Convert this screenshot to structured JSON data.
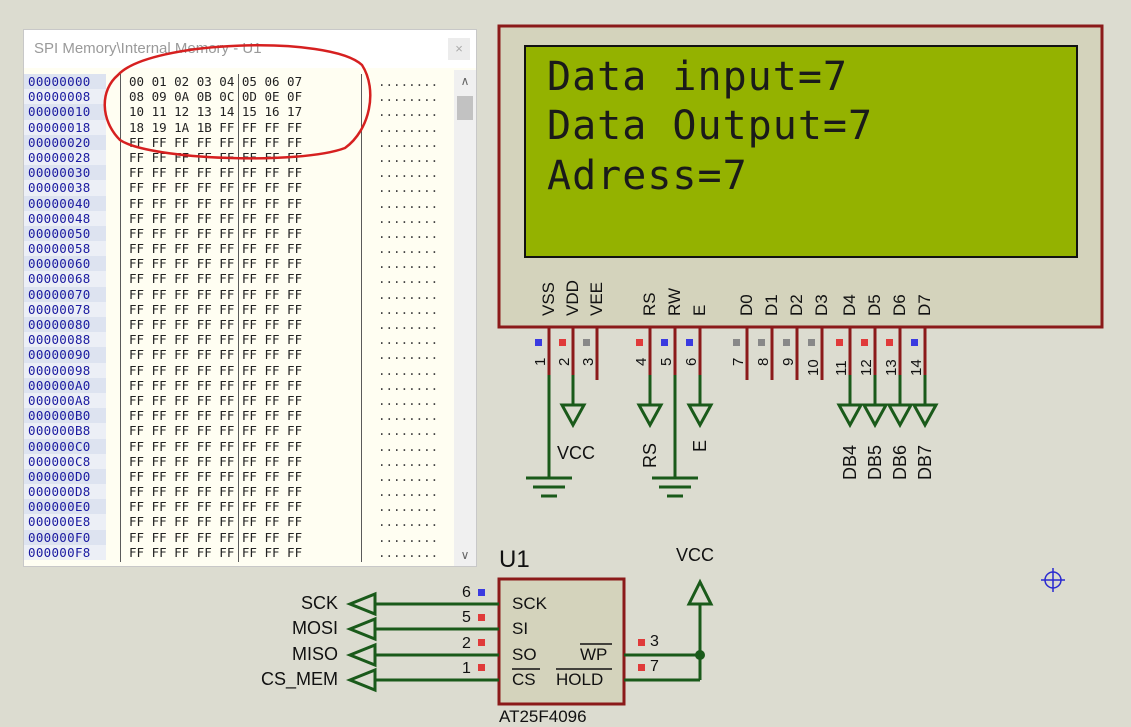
{
  "memory_window": {
    "title": "SPI Memory\\Internal Memory - U1",
    "close_glyph": "×",
    "addresses": [
      "00000000",
      "00000008",
      "00000010",
      "00000018",
      "00000020",
      "00000028",
      "00000030",
      "00000038",
      "00000040",
      "00000048",
      "00000050",
      "00000058",
      "00000060",
      "00000068",
      "00000070",
      "00000078",
      "00000080",
      "00000088",
      "00000090",
      "00000098",
      "000000A0",
      "000000A8",
      "000000B0",
      "000000B8",
      "000000C0",
      "000000C8",
      "000000D0",
      "000000D8",
      "000000E0",
      "000000E8",
      "000000F0",
      "000000F8"
    ],
    "hex_rows": [
      "00 01 02 03 04 05 06 07",
      "08 09 0A 0B 0C 0D 0E 0F",
      "10 11 12 13 14 15 16 17",
      "18 19 1A 1B FF FF FF FF",
      "FF FF FF FF FF FF FF FF",
      "FF FF FF FF FF FF FF FF",
      "FF FF FF FF FF FF FF FF",
      "FF FF FF FF FF FF FF FF",
      "FF FF FF FF FF FF FF FF",
      "FF FF FF FF FF FF FF FF",
      "FF FF FF FF FF FF FF FF",
      "FF FF FF FF FF FF FF FF",
      "FF FF FF FF FF FF FF FF",
      "FF FF FF FF FF FF FF FF",
      "FF FF FF FF FF FF FF FF",
      "FF FF FF FF FF FF FF FF",
      "FF FF FF FF FF FF FF FF",
      "FF FF FF FF FF FF FF FF",
      "FF FF FF FF FF FF FF FF",
      "FF FF FF FF FF FF FF FF",
      "FF FF FF FF FF FF FF FF",
      "FF FF FF FF FF FF FF FF",
      "FF FF FF FF FF FF FF FF",
      "FF FF FF FF FF FF FF FF",
      "FF FF FF FF FF FF FF FF",
      "FF FF FF FF FF FF FF FF",
      "FF FF FF FF FF FF FF FF",
      "FF FF FF FF FF FF FF FF",
      "FF FF FF FF FF FF FF FF",
      "FF FF FF FF FF FF FF FF",
      "FF FF FF FF FF FF FF FF",
      "FF FF FF FF FF FF FF FF"
    ],
    "ascii_row": "........",
    "scroll_down_glyph": "∨",
    "highlight_color": "#d62020"
  },
  "lcd": {
    "lines": [
      "Data input=7",
      "Data Output=7",
      "Adress=7"
    ],
    "screen_color": "#94b200",
    "frame_color": "#8b1a1a",
    "pins": [
      {
        "name": "VSS",
        "num": "1"
      },
      {
        "name": "VDD",
        "num": "2"
      },
      {
        "name": "VEE",
        "num": "3"
      },
      {
        "name": "RS",
        "num": "4"
      },
      {
        "name": "RW",
        "num": "5"
      },
      {
        "name": "E",
        "num": "6"
      },
      {
        "name": "D0",
        "num": "7"
      },
      {
        "name": "D1",
        "num": "8"
      },
      {
        "name": "D2",
        "num": "9"
      },
      {
        "name": "D3",
        "num": "10"
      },
      {
        "name": "D4",
        "num": "11"
      },
      {
        "name": "D5",
        "num": "12"
      },
      {
        "name": "D6",
        "num": "13"
      },
      {
        "name": "D7",
        "num": "14"
      }
    ],
    "net_vcc": "VCC",
    "net_rs": "RS",
    "net_e": "E",
    "net_db": [
      "DB4",
      "DB5",
      "DB6",
      "DB7"
    ]
  },
  "chip": {
    "ref": "U1",
    "part": "AT25F4096",
    "left_pins": [
      {
        "name": "SCK",
        "num": "6"
      },
      {
        "name": "SI",
        "num": "5"
      },
      {
        "name": "SO",
        "num": "2"
      },
      {
        "name": "CS",
        "num": "1"
      }
    ],
    "right_pins": [
      {
        "name": "WP",
        "num": "3"
      },
      {
        "name": "HOLD",
        "num": "7"
      }
    ],
    "nets_left": [
      "SCK",
      "MOSI",
      "MISO",
      "CS_MEM"
    ],
    "net_vcc": "VCC",
    "wire_color": "#1a5a1a",
    "pin_color": "#8b1a1a"
  },
  "cursor_icon": "crosshair-icon"
}
